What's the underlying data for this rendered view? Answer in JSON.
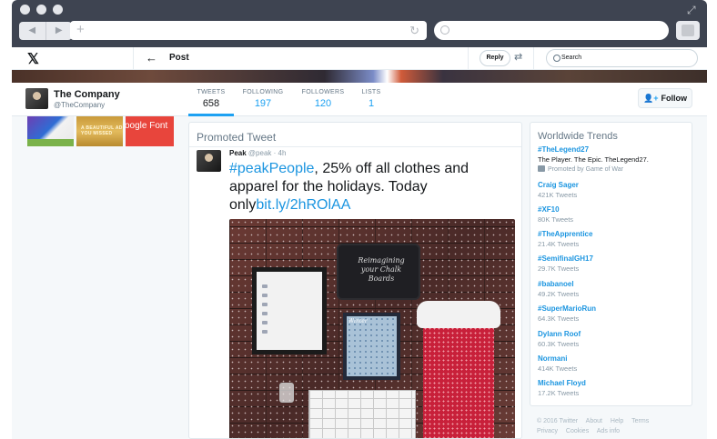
{
  "browser": {
    "back_glyph": "◀",
    "forward_glyph": "▶",
    "new_tab_glyph": "+",
    "reload_glyph": "↻",
    "expand_glyph": "⤢"
  },
  "topbar": {
    "logo": "𝕏",
    "back_glyph": "←",
    "title": "Post",
    "reply_label": "Reply",
    "tune_glyph": "⇄",
    "search_placeholder": "Search"
  },
  "profile": {
    "name": "The Company",
    "handle": "@TheCompany",
    "stats": [
      {
        "label": "TWEETS",
        "value": "658"
      },
      {
        "label": "FOLLOWING",
        "value": "197"
      },
      {
        "label": "FOLLOWERS",
        "value": "120"
      },
      {
        "label": "LISTS",
        "value": "1"
      }
    ],
    "follow_label": "Follow",
    "follow_icon": "👤+"
  },
  "thumbnails": {
    "thumb2_text": "A BEAUTIFUL AD YOU MISSED",
    "thumb3_text": "oogle Font"
  },
  "tweet": {
    "section_title": "Promoted Tweet",
    "author": "Peak",
    "handle": "@peak",
    "separator": "·",
    "time": "4h",
    "hashtag": "#peakPeople",
    "text_mid": ", 25% off all clothes and apparel for the holidays. Today only",
    "link": "bit.ly/2hROlAA",
    "image_chalk_text": "Reimagining your Chalk Boards",
    "image_frame_text": "Winter"
  },
  "trends": {
    "title": "Worldwide Trends",
    "items": [
      {
        "name": "#TheLegend27",
        "desc": "The Player. The Epic. TheLegend27.",
        "promo": "Promoted by Game of War"
      },
      {
        "name": "Craig Sager",
        "count": "421K Tweets"
      },
      {
        "name": "#XF10",
        "count": "80K Tweets"
      },
      {
        "name": "#TheApprentice",
        "count": "21.4K Tweets"
      },
      {
        "name": "#SemifinalGH17",
        "count": "29.7K Tweets"
      },
      {
        "name": "#babanoel",
        "count": "49.2K Tweets"
      },
      {
        "name": "#SuperMarioRun",
        "count": "64.3K Tweets"
      },
      {
        "name": "Dylann Roof",
        "count": "60.3K Tweets"
      },
      {
        "name": "Normani",
        "count": "414K Tweets"
      },
      {
        "name": "Michael Floyd",
        "count": "17.2K Tweets"
      }
    ]
  },
  "footer": {
    "links_row1": [
      "© 2016 Twitter",
      "About",
      "Help",
      "Terms"
    ],
    "links_row2": [
      "Privacy",
      "Cookies",
      "Ads info"
    ]
  },
  "colors": {
    "accent": "#1da1f2",
    "link": "#1b95e0",
    "chrome": "#3e4451"
  }
}
